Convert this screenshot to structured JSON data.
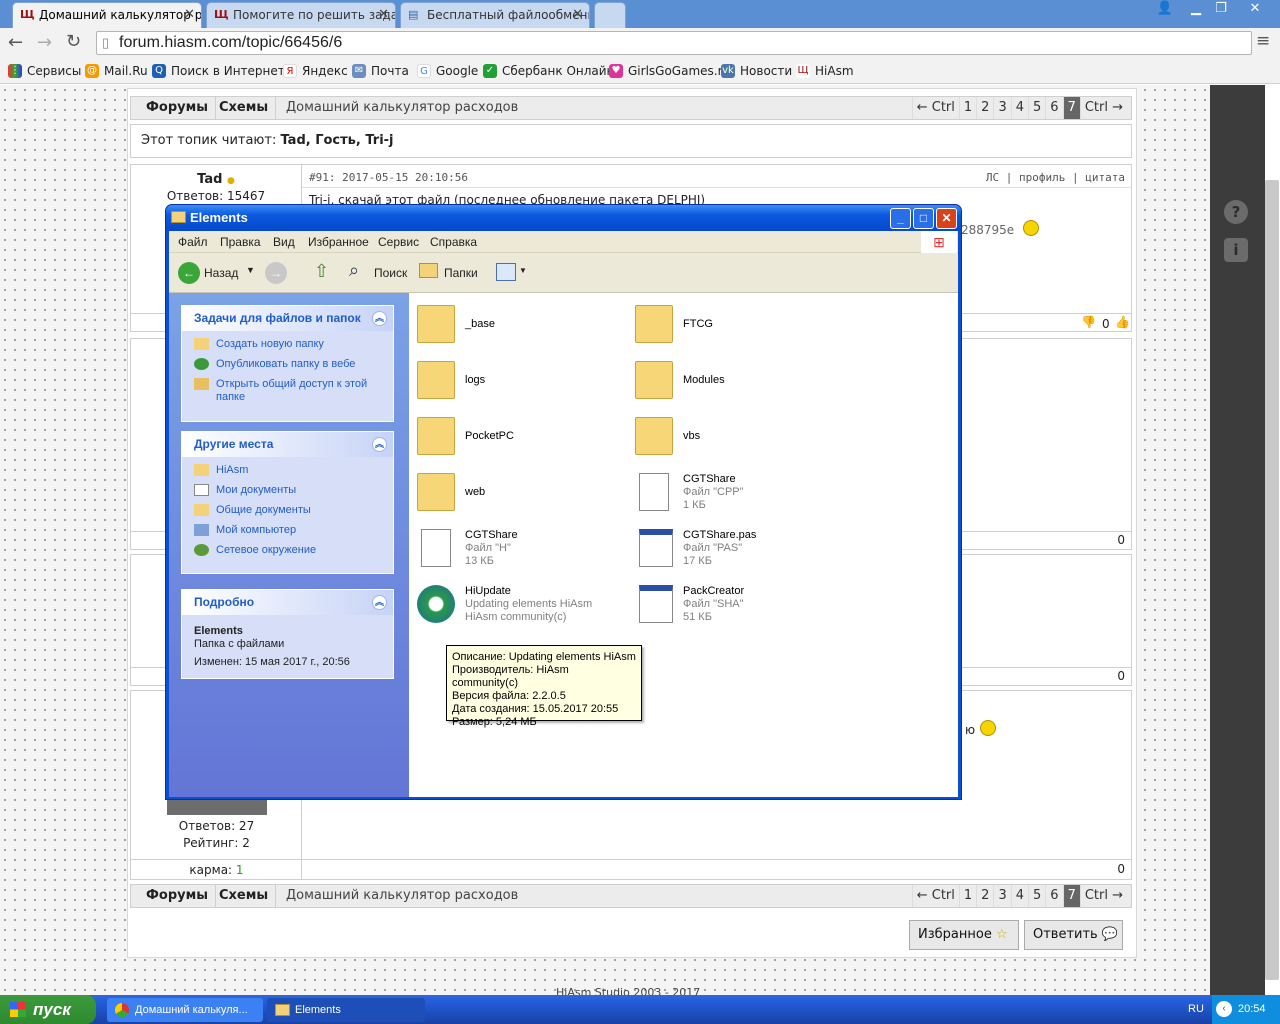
{
  "browser": {
    "tabs": [
      {
        "label": "Домашний калькулятор ра"
      },
      {
        "label": "Помогите по решить задач"
      },
      {
        "label": "Бесплатный файлообменн"
      }
    ],
    "url": "forum.hiasm.com/topic/66456/6",
    "bookmarks": [
      "Сервисы",
      "Mail.Ru",
      "Поиск в Интернете",
      "Яндекс",
      "Почта",
      "Google",
      "Сбербанк Онлайн",
      "GirlsGoGames.ru",
      "Новости",
      "HiAsm"
    ]
  },
  "forum": {
    "nav": {
      "forums": "Форумы",
      "schemes": "Схемы",
      "crumb": "Домашний калькулятор расходов"
    },
    "pager": {
      "prev": "← Ctrl",
      "pages": [
        "1",
        "2",
        "3",
        "4",
        "5",
        "6",
        "7"
      ],
      "current": "7",
      "next": "Ctrl →"
    },
    "readers_label": "Этот топик читают:",
    "readers": "Tad, Гость, Tri-j",
    "post1": {
      "author": "Tad",
      "replies": "Ответов: 15467",
      "header": "#91: 2017-05-15 20:10:56",
      "actions": "ЛС | профиль | цитата",
      "snippet": "Tri-j, скачай этот файл (последнее обновление пакета DELPHI)",
      "hash_tail": "288795e",
      "votes": "0"
    },
    "post_counts": [
      "0",
      "0",
      "0"
    ],
    "post4": {
      "replies": "Ответов: 27",
      "rating": "Рейтинг: 2",
      "karma_label": "карма:",
      "karma": "1",
      "tail": "ю"
    },
    "buttons": {
      "favorites": "Избранное",
      "reply": "Ответить"
    },
    "footer": "HiAsm Studio 2003 - 2017"
  },
  "explorer": {
    "title": "Elements",
    "menu": [
      "Файл",
      "Правка",
      "Вид",
      "Избранное",
      "Сервис",
      "Справка"
    ],
    "toolbar": {
      "back": "Назад",
      "search": "Поиск",
      "folders": "Папки"
    },
    "tasks": {
      "title": "Задачи для файлов и папок",
      "items": [
        "Создать новую папку",
        "Опубликовать папку в вебе",
        "Открыть общий доступ к этой папке"
      ]
    },
    "places": {
      "title": "Другие места",
      "items": [
        "HiAsm",
        "Мои документы",
        "Общие документы",
        "Мой компьютер",
        "Сетевое окружение"
      ]
    },
    "details": {
      "title": "Подробно",
      "name": "Elements",
      "type": "Папка с файлами",
      "modified": "Изменен: 15 мая 2017 г., 20:56"
    },
    "files": [
      {
        "name": "_base",
        "line2": "",
        "line3": ""
      },
      {
        "name": "FTCG",
        "line2": "",
        "line3": ""
      },
      {
        "name": "logs",
        "line2": "",
        "line3": ""
      },
      {
        "name": "Modules",
        "line2": "",
        "line3": ""
      },
      {
        "name": "PocketPC",
        "line2": "",
        "line3": ""
      },
      {
        "name": "vbs",
        "line2": "",
        "line3": ""
      },
      {
        "name": "web",
        "line2": "",
        "line3": ""
      },
      {
        "name": "CGTShare",
        "line2": "Файл \"CPP\"",
        "line3": "1 КБ"
      },
      {
        "name": "CGTShare",
        "line2": "Файл \"H\"",
        "line3": "13 КБ"
      },
      {
        "name": "CGTShare.pas",
        "line2": "Файл \"PAS\"",
        "line3": "17 КБ"
      },
      {
        "name": "HiUpdate",
        "line2": "Updating elements HiAsm",
        "line3": "HiAsm community(c)"
      },
      {
        "name": "PackCreator",
        "line2": "Файл \"SHA\"",
        "line3": "51 КБ"
      }
    ],
    "tooltip": [
      "Описание: Updating elements HiAsm",
      "Производитель: HiAsm community(c)",
      "Версия файла: 2.2.0.5",
      "Дата создания: 15.05.2017 20:55",
      "Размер: 5,24 МБ"
    ]
  },
  "taskbar": {
    "start": "пуск",
    "tasks": [
      "Домашний калькуля...",
      "Elements"
    ],
    "lang": "RU",
    "time": "20:54"
  }
}
